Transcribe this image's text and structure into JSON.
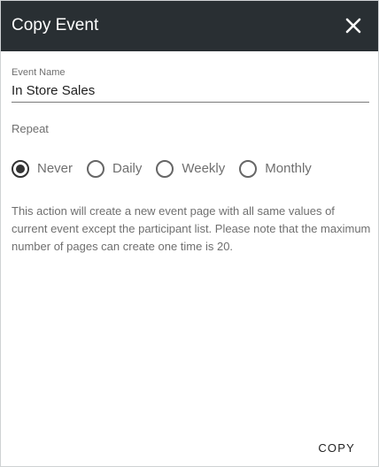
{
  "dialog": {
    "title": "Copy Event",
    "close_icon": "close-icon"
  },
  "event_name": {
    "label": "Event Name",
    "value": "In Store Sales"
  },
  "repeat": {
    "label": "Repeat",
    "selected": "Never",
    "options": [
      "Never",
      "Daily",
      "Weekly",
      "Monthly"
    ]
  },
  "info_text": "This action will create a new event page with all same values of current event except the participant list. Please note that the maximum number of pages can create one time is 20.",
  "actions": {
    "copy_label": "COPY"
  },
  "colors": {
    "header_bg": "#292f33",
    "header_text": "#ffffff",
    "muted_text": "#6f6f6f"
  }
}
